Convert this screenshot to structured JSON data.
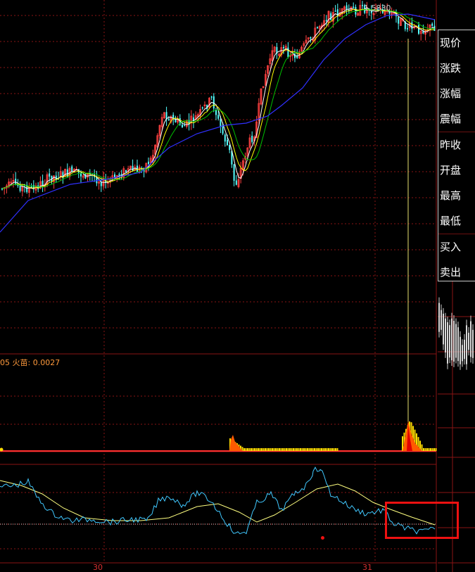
{
  "price_label": "1.5830",
  "indicator": {
    "prefix": "05",
    "name": "火苗",
    "value": "0.0027"
  },
  "x_axis": {
    "labels": [
      "30",
      "31"
    ]
  },
  "info_panel": {
    "items": [
      "现价",
      "涨跌",
      "涨幅",
      "震幅",
      "昨收",
      "开盘",
      "最高",
      "最低",
      "买入",
      "卖出"
    ]
  },
  "colors": {
    "background": "#000000",
    "grid": "#8a1414",
    "candle_up": "#ff4040",
    "candle_down": "#54ffff",
    "ma_fast": "#ffffff",
    "ma_mid": "#ffff00",
    "ma_slow": "#00c000",
    "ma_long": "#3030ff",
    "flame": "#ffdd00",
    "oscillator_fast": "#40c8ff",
    "oscillator_slow": "#ffff80",
    "highlight": "#ee1111"
  }
}
